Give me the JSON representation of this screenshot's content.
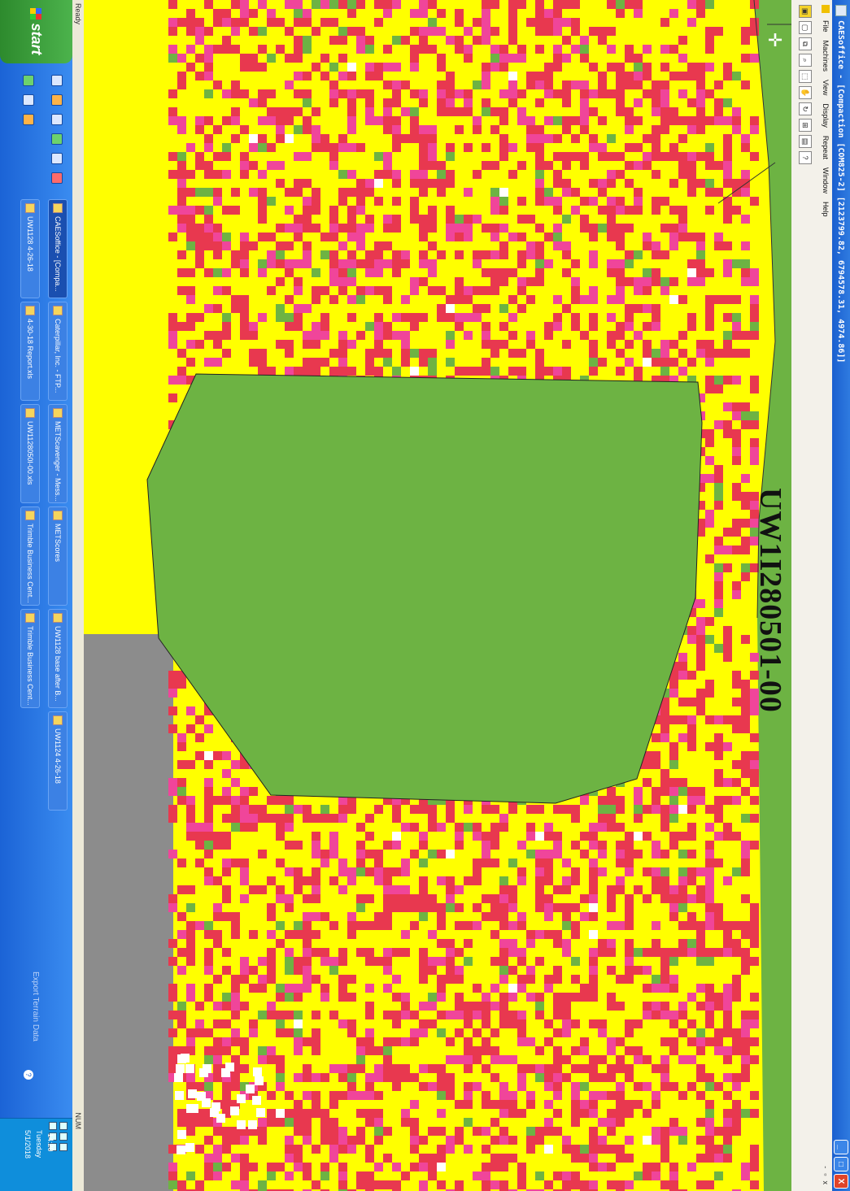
{
  "window": {
    "title": "CAESoffice - [Compaction  [COM825-2]  [2123799.82, 6794578.31, 4974.86]]",
    "controls": {
      "minimize": "_",
      "maximize": "□",
      "close": "X"
    }
  },
  "menu": [
    "File",
    "Machines",
    "View",
    "Display",
    "Repeat",
    "Window",
    "Help"
  ],
  "menu_doc_controls": {
    "minimize": "-",
    "restore": "▫",
    "close": "x"
  },
  "toolbar": {
    "icons": [
      "open-icon",
      "new-icon",
      "copy-icon",
      "zoom-icon",
      "select-icon",
      "hand-icon",
      "refresh-icon",
      "layout-icon",
      "view-icon",
      "help-icon"
    ]
  },
  "map": {
    "label": "UW1I280501-00",
    "legend_colors": {
      "green": "#6db343",
      "yellow": "#ffff00",
      "red": "#e8384f",
      "pink": "#f0459a",
      "gray": "#8c8c8c",
      "white": "#ffffff"
    }
  },
  "status": {
    "left": "Ready",
    "right": "NUM"
  },
  "taskbar": {
    "start_label": "start",
    "tasks": [
      "CAESoffice - [Compa...",
      "UW1128 4-26-18",
      "Caterpillar, Inc. - FTP...",
      "4-30-18 Report.xls",
      "METScavenger - Mess...",
      "UW1128050I-00.xls",
      "METScores",
      "Trimble Business Cent...",
      "UW1128 base after B...",
      "Trimble Business Cent...",
      "UW1124 4-26-18"
    ],
    "export_text": "Export Terrain Data",
    "clock": {
      "time": "14:20",
      "day": "Tuesday",
      "date": "5/1/2018"
    }
  }
}
